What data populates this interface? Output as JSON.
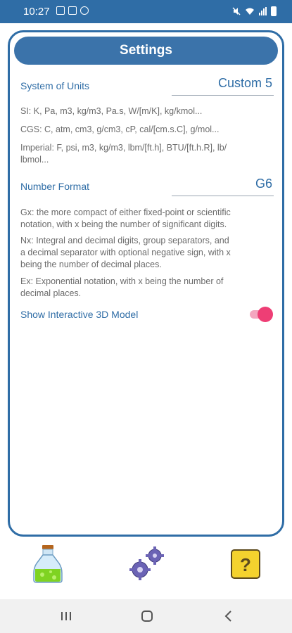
{
  "status_bar": {
    "time": "10:27"
  },
  "header": {
    "title": "Settings"
  },
  "units": {
    "label": "System of Units",
    "value": "Custom 5",
    "si": "SI: K, Pa, m3, kg/m3, Pa.s, W/[m/K], kg/kmol...",
    "cgs": "CGS: C, atm, cm3, g/cm3, cP, cal/[cm.s.C], g/mol...",
    "imperial_line1": "Imperial: F, psi, m3, kg/m3, lbm/[ft.h], BTU/[ft.h.R], lb/",
    "imperial_line2": "lbmol..."
  },
  "number_format": {
    "label": "Number Format",
    "value": "G6",
    "gx_line1": "Gx: the more compact of either fixed-point or scientific",
    "gx_line2": "notation, with x being the number of significant digits.",
    "nx_line1": "Nx: Integral and decimal digits, group separators, and",
    "nx_line2": "a decimal separator with optional negative sign, with x",
    "nx_line3": "being the number of decimal places.",
    "ex_line1": "Ex: Exponential notation, with x being the number of",
    "ex_line2": "decimal places."
  },
  "model_toggle": {
    "label": "Show Interactive 3D Model",
    "checked": true
  },
  "toolbar": {
    "icons": [
      "flask-icon",
      "gears-icon",
      "help-icon"
    ]
  },
  "colors": {
    "primary": "#2f6da6",
    "header": "#3b73aa",
    "toggle_on": "#ee3e75",
    "text_muted": "#6b6b6b"
  }
}
